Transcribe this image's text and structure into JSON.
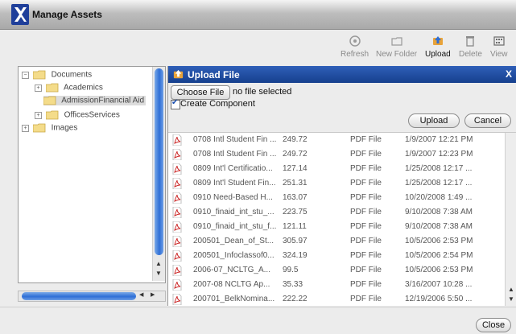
{
  "window": {
    "title": "Manage Assets"
  },
  "toolbar": {
    "refresh": "Refresh",
    "new_folder": "New Folder",
    "upload": "Upload",
    "delete": "Delete",
    "view": "View"
  },
  "tree": {
    "documents": "Documents",
    "academics": "Academics",
    "admission": "AdmissionFinancial Aid",
    "offices": "OfficesServices",
    "images": "Images"
  },
  "upload_panel": {
    "title": "Upload File",
    "close": "X",
    "choose_file": "Choose File",
    "no_file": "no file selected",
    "create_component": "Create Component",
    "upload_button": "Upload",
    "cancel_button": "Cancel"
  },
  "files": [
    {
      "name": "0708 Intl Student Fin ...",
      "size": "249.72",
      "type": "PDF File",
      "date": "1/9/2007 12:21 PM"
    },
    {
      "name": "0708 Intl Student Fin ...",
      "size": "249.72",
      "type": "PDF File",
      "date": "1/9/2007 12:23 PM"
    },
    {
      "name": "0809 Int'l Certificatio...",
      "size": "127.14",
      "type": "PDF File",
      "date": "1/25/2008 12:17 ..."
    },
    {
      "name": "0809 Int'l Student Fin...",
      "size": "251.31",
      "type": "PDF File",
      "date": "1/25/2008 12:17 ..."
    },
    {
      "name": "0910 Need-Based H...",
      "size": "163.07",
      "type": "PDF File",
      "date": "10/20/2008 1:49 ..."
    },
    {
      "name": "0910_finaid_int_stu_...",
      "size": "223.75",
      "type": "PDF File",
      "date": "9/10/2008 7:38 AM"
    },
    {
      "name": "0910_finaid_int_stu_f...",
      "size": "121.11",
      "type": "PDF File",
      "date": "9/10/2008 7:38 AM"
    },
    {
      "name": "200501_Dean_of_St...",
      "size": "305.97",
      "type": "PDF File",
      "date": "10/5/2006 2:53 PM"
    },
    {
      "name": "200501_Infoclassof0...",
      "size": "324.19",
      "type": "PDF File",
      "date": "10/5/2006 2:54 PM"
    },
    {
      "name": "2006-07_NCLTG_A...",
      "size": "99.5",
      "type": "PDF File",
      "date": "10/5/2006 2:53 PM"
    },
    {
      "name": "2007-08 NCLTG Ap...",
      "size": "35.33",
      "type": "PDF File",
      "date": "3/16/2007 10:28 ..."
    },
    {
      "name": "200701_BelkNomina...",
      "size": "222.22",
      "type": "PDF File",
      "date": "12/19/2006 5:50 ..."
    }
  ],
  "footer": {
    "close": "Close"
  }
}
